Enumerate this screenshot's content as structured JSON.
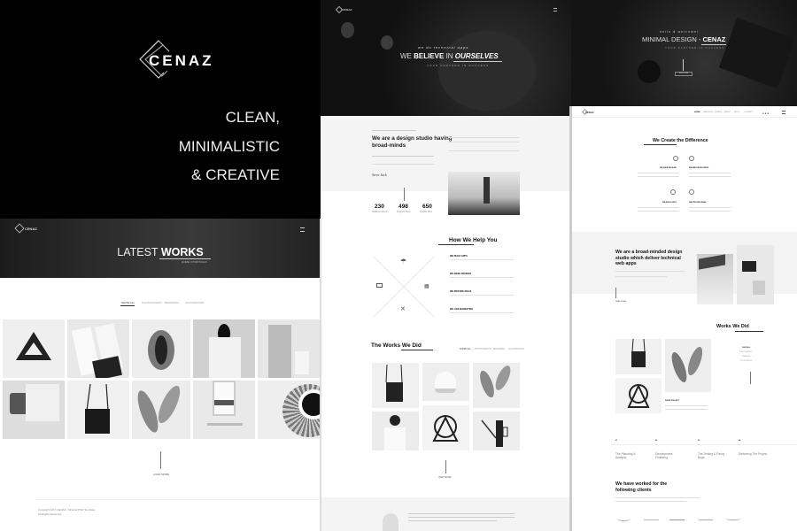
{
  "panel1": {
    "brand": "CENAZ",
    "tagline": [
      "CLEAN,",
      "MINIMALISTIC",
      "& CREATIVE"
    ],
    "page_header": {
      "title_light": "LATEST ",
      "title_bold": "WORKS",
      "breadcrumb": "HOME / PORTFOLIO"
    },
    "filters": [
      "SHOW ALL",
      "PHOTOGRAPHY",
      "BRANDING",
      "ILLUSTRATION"
    ],
    "load_more": "LOAD MORE",
    "footer": {
      "copyright": "Copyright 2017 CENAZ - Minimal PSD Template",
      "rights": "All Rights Reserved"
    }
  },
  "panel2": {
    "hero": {
      "kicker": "we do technical apps",
      "title_a": "WE ",
      "title_b": "BELIEVE",
      "title_c": " IN ",
      "title_d": "OURSELVES",
      "sub": "YOUR PARTNER IN SUCCESS"
    },
    "about": {
      "title": "We are a design studio having broad-minds",
      "signature": "Steve Jack"
    },
    "stats": [
      {
        "value": "230",
        "label": "Satisfied Clients"
      },
      {
        "value": "498",
        "label": "Projects Done"
      },
      {
        "value": "650",
        "label": "Awards Won"
      }
    ],
    "help": {
      "title": "How We Help You",
      "services": [
        "WE BUILD APPS",
        "WE MAKE DESIGNS",
        "WE PROVIDE IDEAS",
        "WE LIKE MARKETING"
      ]
    },
    "works": {
      "title_a": "The Works ",
      "title_b": "We Did",
      "filters": [
        "SHOW ALL",
        "PHOTOGRAPHY",
        "BRANDING",
        "ILLUSTRATION"
      ]
    },
    "view_more": "VIEW MORE"
  },
  "panel3": {
    "hero": {
      "kicker": "hello & welcome!",
      "title_a": "MINIMAL DESIGN - ",
      "title_b": "CENAZ",
      "sub": "YOUR PARTNER IN SUCCESS",
      "button": "EXPLORE"
    },
    "nav": {
      "brand": "CENAZ",
      "items": [
        "HOME",
        "SERVICES",
        "WORKS",
        "ABOUT",
        "BLOG",
        "CONTACT"
      ]
    },
    "difference": {
      "title": "We Create the Difference",
      "features": [
        "WE HAVE DESIGNS",
        "WE ARE DEVELOPERS",
        "WE BUILD APPS",
        "WE PROVIDE IDEAS"
      ]
    },
    "broad": {
      "title": "We are a broad-minded design studio which deliver technical web apps",
      "link": "READ MORE"
    },
    "works": {
      "title": "Works We Did",
      "filters": [
        "SHOW ALL",
        "PHOTOGRAPHY",
        "BRANDING",
        "ILLUSTRATION"
      ],
      "item_title": "WORK PROJECT"
    },
    "process": [
      {
        "num": "01",
        "label": "The Planning & Analysis"
      },
      {
        "num": "02",
        "label": "Development Finalizing"
      },
      {
        "num": "03",
        "label": "The Testing & Fixing Bugs"
      },
      {
        "num": "04",
        "label": "Delivering The Project"
      }
    ],
    "clients": {
      "title": "We have worked for the following clients"
    }
  }
}
